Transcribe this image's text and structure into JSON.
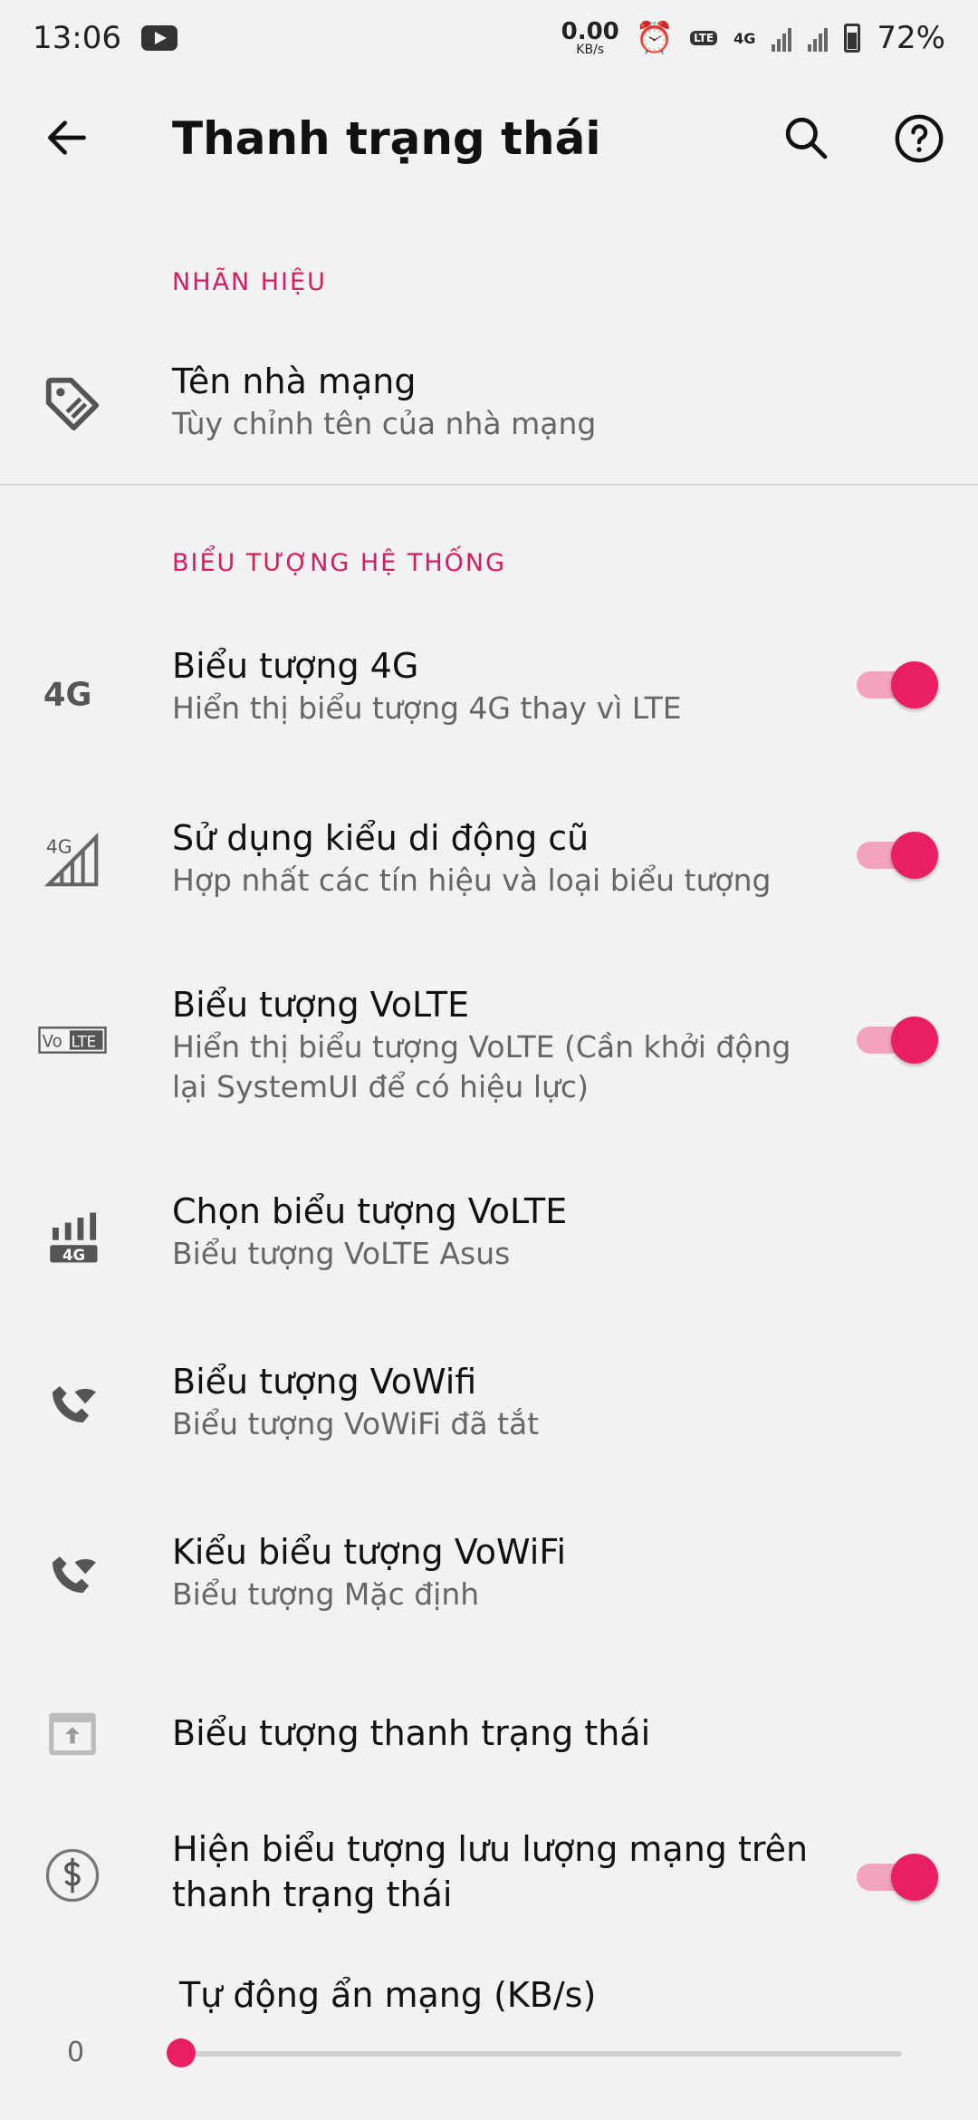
{
  "status_bar": {
    "time": "13:06",
    "net_speed_value": "0.00",
    "net_speed_unit": "KB/s",
    "volte_label": "LTE",
    "network_type": "4G",
    "battery": "72%"
  },
  "app_bar": {
    "title": "Thanh trạng thái"
  },
  "sections": {
    "brand_header": "NHÃN HIỆU",
    "system_icons_header": "BIỂU TƯỢNG HỆ THỐNG"
  },
  "carrier": {
    "title": "Tên nhà mạng",
    "subtitle": "Tùy chỉnh tên của nhà mạng"
  },
  "items": [
    {
      "title": "Biểu tượng 4G",
      "subtitle": "Hiển thị biểu tượng 4G thay vì LTE",
      "toggle": true,
      "icon": "4g-icon"
    },
    {
      "title": "Sử dụng kiểu di động cũ",
      "subtitle": "Hợp nhất các tín hiệu và loại biểu tượng",
      "toggle": true,
      "icon": "signal-4g-icon"
    },
    {
      "title": "Biểu tượng VoLTE",
      "subtitle": "Hiển thị biểu tượng VoLTE (Cần khởi động lại SystemUI để có hiệu lực)",
      "toggle": true,
      "icon": "volte-icon"
    },
    {
      "title": "Chọn biểu tượng VoLTE",
      "subtitle": "Biểu tượng VoLTE Asus",
      "toggle": null,
      "icon": "signal-bars-4g-icon"
    },
    {
      "title": "Biểu tượng VoWifi",
      "subtitle": "Biểu tượng VoWiFi đã tắt",
      "toggle": null,
      "icon": "wifi-call-icon"
    },
    {
      "title": "Kiểu biểu tượng VoWiFi",
      "subtitle": "Biểu tượng Mặc định",
      "toggle": null,
      "icon": "wifi-call-icon"
    },
    {
      "title": "Biểu tượng thanh trạng thái",
      "subtitle": "",
      "toggle": null,
      "icon": "status-bar-icon"
    },
    {
      "title": "Hiện biểu tượng lưu lượng mạng trên thanh trạng thái",
      "subtitle": "",
      "toggle": true,
      "icon": "data-usage-icon"
    }
  ],
  "slider": {
    "title": "Tự động ẩn mạng (KB/s)",
    "value": "0",
    "fraction": 0
  },
  "colors": {
    "accent": "#e91e63",
    "section_header": "#d81b60",
    "background": "#f2f2f2"
  }
}
